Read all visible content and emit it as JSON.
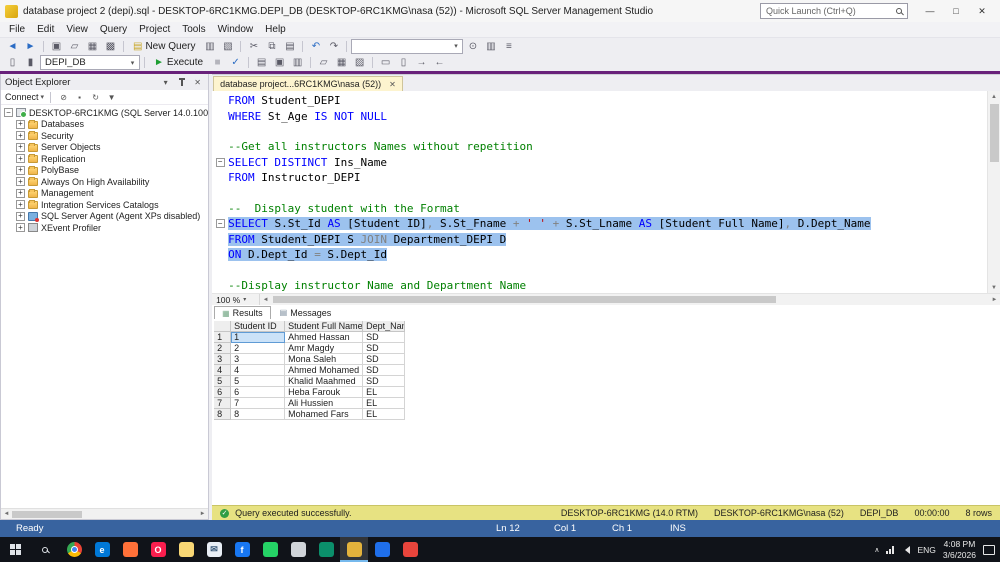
{
  "window": {
    "title": "database project 2 (depi).sql - DESKTOP-6RC1KMG.DEPI_DB (DESKTOP-6RC1KMG\\nasa (52)) - Microsoft SQL Server Management Studio",
    "quick_launch": "Quick Launch (Ctrl+Q)",
    "controls": {
      "minimize": "—",
      "maximize": "□",
      "close": "✕"
    }
  },
  "menu": {
    "items": [
      "File",
      "Edit",
      "View",
      "Query",
      "Project",
      "Tools",
      "Window",
      "Help"
    ]
  },
  "toolbar_standard": {
    "items": [
      {
        "type": "icon",
        "name": "nav-backward",
        "glyph": "◄",
        "color": "blue"
      },
      {
        "type": "icon",
        "name": "nav-forward",
        "glyph": "►",
        "color": "blue"
      },
      {
        "type": "sep"
      },
      {
        "type": "icon",
        "name": "new-project",
        "glyph": "▣"
      },
      {
        "type": "icon",
        "name": "open-file",
        "glyph": "▱"
      },
      {
        "type": "icon",
        "name": "save",
        "glyph": "▦"
      },
      {
        "type": "icon",
        "name": "save-all",
        "glyph": "▩"
      },
      {
        "type": "sep"
      },
      {
        "type": "button",
        "name": "new-query-button",
        "glyph": "▤",
        "label": "New Query",
        "color": "gold"
      },
      {
        "type": "icon",
        "name": "new-database-engine-query",
        "glyph": "▥"
      },
      {
        "type": "icon",
        "name": "new-analysis-query",
        "glyph": "▧"
      },
      {
        "type": "sep"
      },
      {
        "type": "icon",
        "name": "cut",
        "glyph": "✂"
      },
      {
        "type": "icon",
        "name": "copy",
        "glyph": "⧉"
      },
      {
        "type": "icon",
        "name": "paste",
        "glyph": "▤"
      },
      {
        "type": "sep"
      },
      {
        "type": "icon",
        "name": "undo",
        "glyph": "↶",
        "color": "blue"
      },
      {
        "type": "icon",
        "name": "redo",
        "glyph": "↷"
      },
      {
        "type": "sep"
      },
      {
        "type": "combo",
        "name": "toolbar-combobox",
        "value": "",
        "width": 112
      },
      {
        "type": "icon",
        "name": "find",
        "glyph": "⊙"
      },
      {
        "type": "icon",
        "name": "activity-monitor",
        "glyph": "▥"
      },
      {
        "type": "icon",
        "name": "outline",
        "glyph": "≡"
      }
    ]
  },
  "toolbar_query": {
    "items": [
      {
        "type": "icon",
        "name": "connect-database",
        "glyph": "▯"
      },
      {
        "type": "icon",
        "name": "change-connection",
        "glyph": "▮"
      },
      {
        "type": "combo",
        "name": "available-databases-combo",
        "value": "DEPI_DB",
        "width": 100
      },
      {
        "type": "sep"
      },
      {
        "type": "button",
        "name": "execute-button",
        "glyph": "►",
        "label": "Execute",
        "color": "green"
      },
      {
        "type": "icon",
        "name": "cancel-query",
        "glyph": "■",
        "color": "dim"
      },
      {
        "type": "icon",
        "name": "parse-query",
        "glyph": "✓",
        "color": "blue"
      },
      {
        "type": "sep"
      },
      {
        "type": "icon",
        "name": "display-estimated-plan",
        "glyph": "▤"
      },
      {
        "type": "icon",
        "name": "query-options",
        "glyph": "▣"
      },
      {
        "type": "icon",
        "name": "intellisense-enabled",
        "glyph": "▥"
      },
      {
        "type": "sep"
      },
      {
        "type": "icon",
        "name": "results-to-text",
        "glyph": "▱"
      },
      {
        "type": "icon",
        "name": "results-to-grid",
        "glyph": "▦"
      },
      {
        "type": "icon",
        "name": "results-to-file",
        "glyph": "▨"
      },
      {
        "type": "sep"
      },
      {
        "type": "icon",
        "name": "comment-selection",
        "glyph": "▭"
      },
      {
        "type": "icon",
        "name": "uncomment-selection",
        "glyph": "▯"
      },
      {
        "type": "icon",
        "name": "indent",
        "glyph": "→"
      },
      {
        "type": "icon",
        "name": "outdent",
        "glyph": "←"
      }
    ]
  },
  "object_explorer": {
    "title": "Object Explorer",
    "connect_label": "Connect",
    "tree": [
      {
        "label": "DESKTOP-6RC1KMG (SQL Server 14.0.100",
        "icon": "server",
        "level": 0,
        "expand": "minus"
      },
      {
        "label": "Databases",
        "icon": "folder",
        "level": 1,
        "expand": "plus"
      },
      {
        "label": "Security",
        "icon": "folder",
        "level": 1,
        "expand": "plus"
      },
      {
        "label": "Server Objects",
        "icon": "folder",
        "level": 1,
        "expand": "plus"
      },
      {
        "label": "Replication",
        "icon": "folder",
        "level": 1,
        "expand": "plus"
      },
      {
        "label": "PolyBase",
        "icon": "folder",
        "level": 1,
        "expand": "plus"
      },
      {
        "label": "Always On High Availability",
        "icon": "folder",
        "level": 1,
        "expand": "plus"
      },
      {
        "label": "Management",
        "icon": "folder",
        "level": 1,
        "expand": "plus"
      },
      {
        "label": "Integration Services Catalogs",
        "icon": "folder",
        "level": 1,
        "expand": "plus"
      },
      {
        "label": "SQL Server Agent (Agent XPs disabled)",
        "icon": "agent",
        "level": 1,
        "expand": "plus"
      },
      {
        "label": "XEvent Profiler",
        "icon": "profiler",
        "level": 1,
        "expand": "plus"
      }
    ]
  },
  "editor": {
    "tab_label": "database project...6RC1KMG\\nasa (52))",
    "zoom": "100 %",
    "lines": [
      {
        "tokens": [
          [
            "kw",
            "FROM"
          ],
          [
            "id",
            " Student_DEPI"
          ]
        ]
      },
      {
        "tokens": [
          [
            "kw",
            "WHERE"
          ],
          [
            "id",
            " St_Age "
          ],
          [
            "kw",
            "IS NOT NULL"
          ]
        ]
      },
      {
        "tokens": []
      },
      {
        "tokens": [
          [
            "cm",
            "--Get all instructors Names without repetition"
          ]
        ]
      },
      {
        "fold": true,
        "tokens": [
          [
            "kw",
            "SELECT DISTINCT"
          ],
          [
            "id",
            " Ins_Name"
          ]
        ]
      },
      {
        "tokens": [
          [
            "kw",
            "FROM"
          ],
          [
            "id",
            " Instructor_DEPI"
          ]
        ]
      },
      {
        "tokens": []
      },
      {
        "tokens": [
          [
            "cm",
            "--  Display student with the Format"
          ]
        ]
      },
      {
        "fold": true,
        "sel": true,
        "tokens": [
          [
            "kw",
            "SELECT"
          ],
          [
            "id",
            " S.St_Id "
          ],
          [
            "kw",
            "AS"
          ],
          [
            "id",
            " [Student ID]"
          ],
          [
            "op",
            ","
          ],
          [
            "id",
            " S.St_Fname"
          ],
          [
            "op",
            " + "
          ],
          [
            "str",
            "' '"
          ],
          [
            "op",
            " + "
          ],
          [
            "id",
            "S.St_Lname "
          ],
          [
            "kw",
            "AS"
          ],
          [
            "id",
            " [Student Full Name]"
          ],
          [
            "op",
            ","
          ],
          [
            "id",
            " D.Dept_Name"
          ]
        ]
      },
      {
        "sel": true,
        "tokens": [
          [
            "kw",
            "FROM"
          ],
          [
            "id",
            " Student_DEPI S "
          ],
          [
            "op",
            "JOIN"
          ],
          [
            "id",
            " Department_DEPI D"
          ]
        ]
      },
      {
        "sel": true,
        "tokens": [
          [
            "kw",
            "ON"
          ],
          [
            "id",
            " D.Dept_Id "
          ],
          [
            "op",
            "="
          ],
          [
            "id",
            " S.Dept_Id"
          ]
        ]
      },
      {
        "tokens": []
      },
      {
        "tokens": [
          [
            "cm",
            "--Display instructor Name and Department Name"
          ]
        ]
      }
    ]
  },
  "results": {
    "tabs": [
      "Results",
      "Messages"
    ],
    "columns": [
      "Student ID",
      "Student Full Name",
      "Dept_Name"
    ],
    "rows": [
      [
        "1",
        "Ahmed Hassan",
        "SD"
      ],
      [
        "2",
        "Amr Magdy",
        "SD"
      ],
      [
        "3",
        "Mona Saleh",
        "SD"
      ],
      [
        "4",
        "Ahmed Mohamed",
        "SD"
      ],
      [
        "5",
        "Khalid Maahmed",
        "SD"
      ],
      [
        "6",
        "Heba Farouk",
        "EL"
      ],
      [
        "7",
        "Ali Hussien",
        "EL"
      ],
      [
        "8",
        "Mohamed Fars",
        "EL"
      ]
    ]
  },
  "status": {
    "query_status": "Query executed successfully.",
    "server": "DESKTOP-6RC1KMG (14.0 RTM)",
    "user": "DESKTOP-6RC1KMG\\nasa (52)",
    "database": "DEPI_DB",
    "elapsed": "00:00:00",
    "row_count": "8 rows",
    "ready": "Ready",
    "line": "Ln 12",
    "column": "Col 1",
    "char": "Ch 1",
    "mode": "INS"
  },
  "taskbar": {
    "apps": [
      {
        "name": "chrome",
        "color": "#ea4335"
      },
      {
        "name": "edge",
        "color": "#0078d7",
        "letter": "e"
      },
      {
        "name": "firefox",
        "color": "#ff7139"
      },
      {
        "name": "opera",
        "color": "#fa1e4e",
        "letter": "O"
      },
      {
        "name": "file-explorer",
        "color": "#f8d775"
      },
      {
        "name": "mail",
        "color": "#e8eef5",
        "letter": "✉"
      },
      {
        "name": "facebook",
        "color": "#1877f2",
        "letter": "f"
      },
      {
        "name": "whatsapp",
        "color": "#25d366"
      },
      {
        "name": "snipping-tool",
        "color": "#d0d4d9"
      },
      {
        "name": "store",
        "color": "#0b8f6b"
      },
      {
        "name": "ssms",
        "color": "#e3b23c",
        "active": true
      },
      {
        "name": "photos",
        "color": "#1f6feb"
      },
      {
        "name": "browser",
        "color": "#e8453c"
      }
    ],
    "tray": {
      "lang": "ENG",
      "time": "4:08 PM",
      "date": "3/6/2026"
    }
  }
}
